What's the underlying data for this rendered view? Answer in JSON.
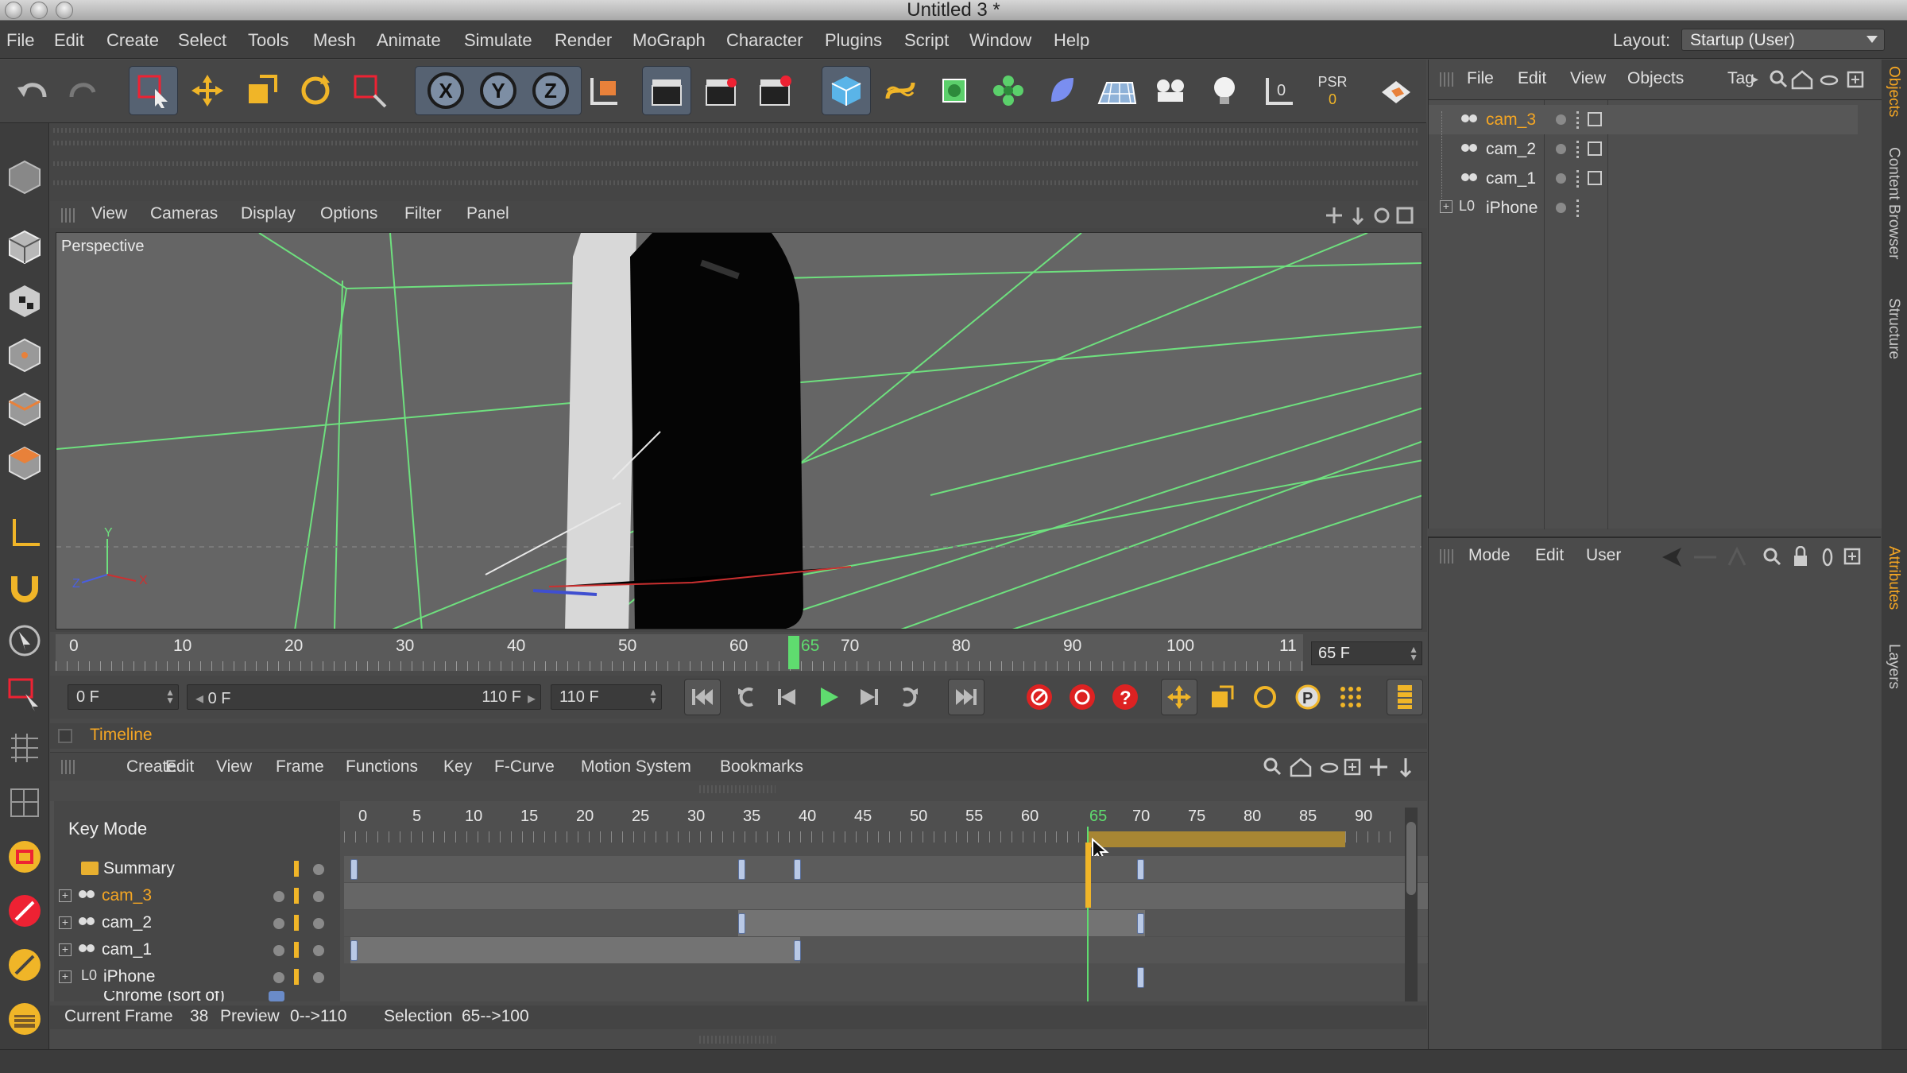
{
  "window": {
    "title": "Untitled 3 *"
  },
  "menubar": {
    "items": [
      "File",
      "Edit",
      "Create",
      "Select",
      "Tools",
      "Mesh",
      "Animate",
      "Simulate",
      "Render",
      "MoGraph",
      "Character",
      "Plugins",
      "Script",
      "Window",
      "Help"
    ],
    "layout_label": "Layout:",
    "layout_value": "Startup (User)"
  },
  "toolbar": {
    "axis_x": "X",
    "axis_y": "Y",
    "axis_z": "Z",
    "psr": "PSR",
    "psr_value": "0"
  },
  "viewport": {
    "menu": [
      "View",
      "Cameras",
      "Display",
      "Options",
      "Filter",
      "Panel"
    ],
    "label": "Perspective",
    "axis_x": "X",
    "axis_y": "Y",
    "axis_z": "Z"
  },
  "ruler": {
    "ticks": [
      "0",
      "10",
      "20",
      "30",
      "40",
      "50",
      "60",
      "65",
      "70",
      "80",
      "90",
      "100",
      "11"
    ],
    "current": "65",
    "frame_field": "65 F"
  },
  "transport": {
    "start": "0 F",
    "range_start": "0 F",
    "range_end": "110 F",
    "end": "110 F"
  },
  "timeline": {
    "title": "Timeline",
    "menu": [
      "Create",
      "Edit",
      "View",
      "Frame",
      "Functions",
      "Key",
      "F-Curve",
      "Motion System",
      "Bookmarks"
    ],
    "key_mode": "Key Mode",
    "ticks": [
      "0",
      "5",
      "10",
      "15",
      "20",
      "25",
      "30",
      "35",
      "40",
      "45",
      "50",
      "55",
      "60",
      "65",
      "70",
      "75",
      "80",
      "85",
      "90"
    ],
    "current": "65",
    "rows": [
      {
        "name": "Summary",
        "color": "#eeeeee"
      },
      {
        "name": "cam_3",
        "color": "#f5a623"
      },
      {
        "name": "cam_2",
        "color": "#eeeeee"
      },
      {
        "name": "cam_1",
        "color": "#eeeeee"
      },
      {
        "name": "iPhone",
        "color": "#eeeeee"
      },
      {
        "name": "Chrome (sort of)",
        "color": "#eeeeee"
      }
    ]
  },
  "status": {
    "current_frame_label": "Current Frame",
    "current_frame": "38",
    "preview_label": "Preview",
    "preview": "0-->110",
    "selection_label": "Selection",
    "selection": "65-->100"
  },
  "objects_panel": {
    "menu": [
      "File",
      "Edit",
      "View",
      "Objects",
      "Tag"
    ],
    "items": [
      {
        "name": "cam_3",
        "color": "#f5a623"
      },
      {
        "name": "cam_2",
        "color": "#e6e6e6"
      },
      {
        "name": "cam_1",
        "color": "#e6e6e6"
      },
      {
        "name": "iPhone",
        "color": "#e6e6e6"
      }
    ]
  },
  "attributes_panel": {
    "menu": [
      "Mode",
      "Edit",
      "User"
    ]
  },
  "side_tabs": [
    "Objects",
    "Content Browser",
    "Structure",
    "Attributes",
    "Layers"
  ]
}
